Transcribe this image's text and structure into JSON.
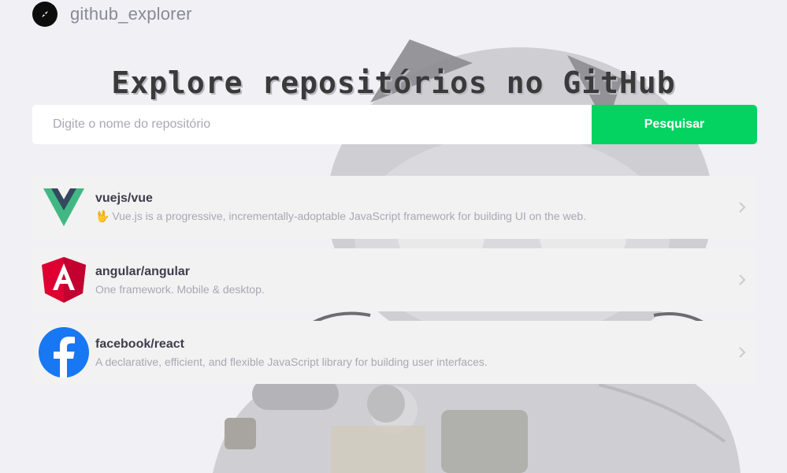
{
  "header": {
    "app_name": "github_explorer"
  },
  "main": {
    "title": "Explore repositórios no GitHub"
  },
  "search": {
    "placeholder": "Digite o nome do repositório",
    "value": "",
    "button_label": "Pesquisar"
  },
  "repositories": [
    {
      "name": "vuejs/vue",
      "description": "🖖 Vue.js is a progressive, incrementally-adoptable JavaScript framework for building UI on the web.",
      "avatar_icon": "vue-logo-icon"
    },
    {
      "name": "angular/angular",
      "description": "One framework. Mobile & desktop.",
      "avatar_icon": "angular-logo-icon"
    },
    {
      "name": "facebook/react",
      "description": "A declarative, efficient, and flexible JavaScript library for building user interfaces.",
      "avatar_icon": "facebook-logo-icon"
    }
  ],
  "colors": {
    "background": "#f0f0f5",
    "accent": "#04d361",
    "title": "#3a3a3a",
    "muted_text": "#a8a8b3"
  }
}
